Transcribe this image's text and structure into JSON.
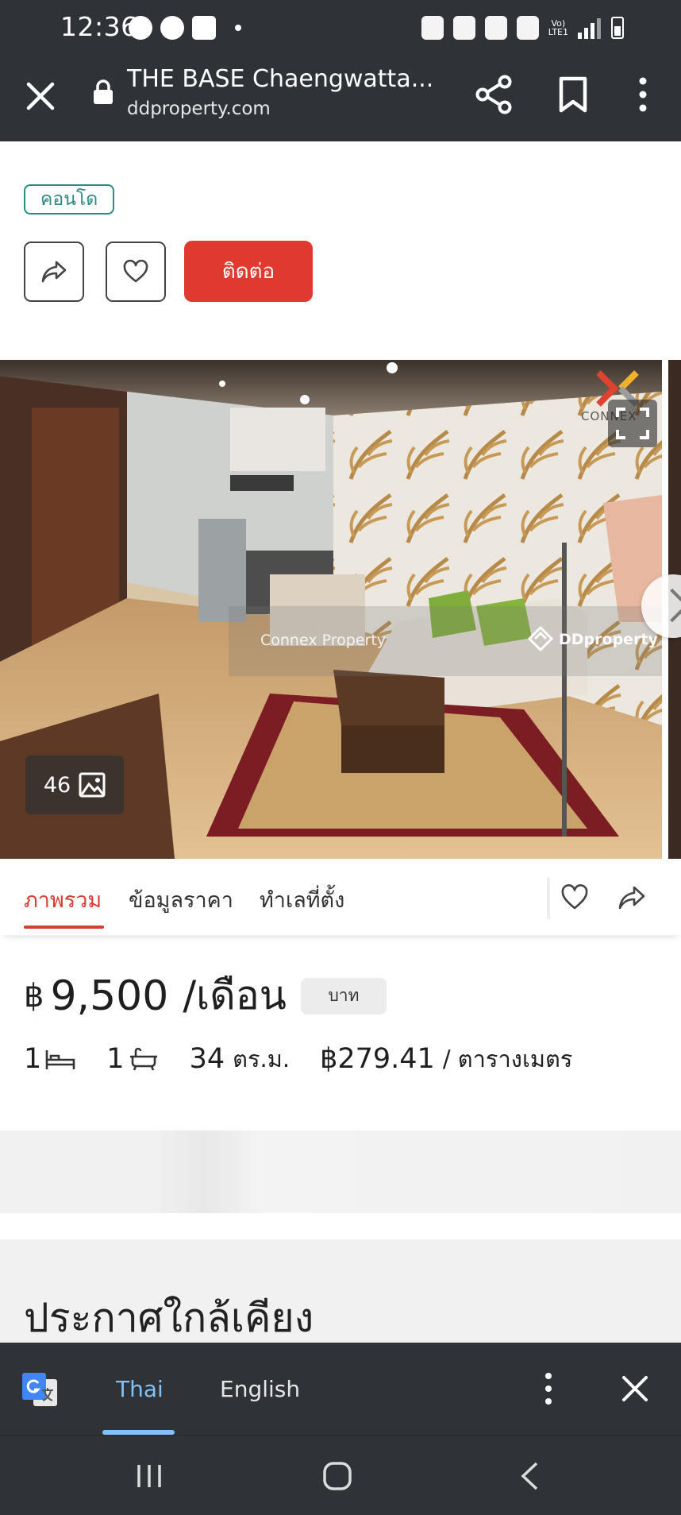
{
  "status_bar": {
    "time": "12:36",
    "network_label_top": "Vo)",
    "network_label_bottom": "LTE1"
  },
  "browser": {
    "title": "THE BASE Chaengwatta...",
    "url": "ddproperty.com"
  },
  "listing": {
    "type_tag": "คอนโด",
    "contact_label": "ติดต่อ",
    "photo_count": "46",
    "watermark_agent": "Connex Property",
    "watermark_site": "DDproperty",
    "brand_logo_text": "CONNEX"
  },
  "tabs": [
    {
      "label": "ภาพรวม",
      "active": true
    },
    {
      "label": "ข้อมูลราคา",
      "active": false
    },
    {
      "label": "ทำเลที่ตั้ง",
      "active": false
    }
  ],
  "price": {
    "currency_symbol": "฿",
    "amount": "9,500",
    "period": "/เดือน",
    "currency_chip": "บาท"
  },
  "facts": {
    "bedrooms": "1",
    "bathrooms": "1",
    "area_value": "34",
    "area_unit": "ตร.ม.",
    "price_per_area": "฿279.41",
    "price_per_area_unit": "/ ตารางเมตร"
  },
  "nearby": {
    "title": "ประกาศใกล้เคียง"
  },
  "translate_bar": {
    "lang_active": "Thai",
    "lang_other": "English"
  },
  "colors": {
    "accent_red": "#e03a30",
    "tag_teal": "#2a8a84",
    "chrome_dark": "#2f3337",
    "translate_active": "#82c1f5"
  },
  "icons": [
    "close-icon",
    "lock-icon",
    "share-icon",
    "bookmark-icon",
    "more-vert-icon",
    "heart-icon",
    "expand-icon",
    "gallery-icon",
    "bed-icon",
    "bath-icon",
    "google-translate-icon",
    "recents-icon",
    "home-icon",
    "back-icon"
  ]
}
